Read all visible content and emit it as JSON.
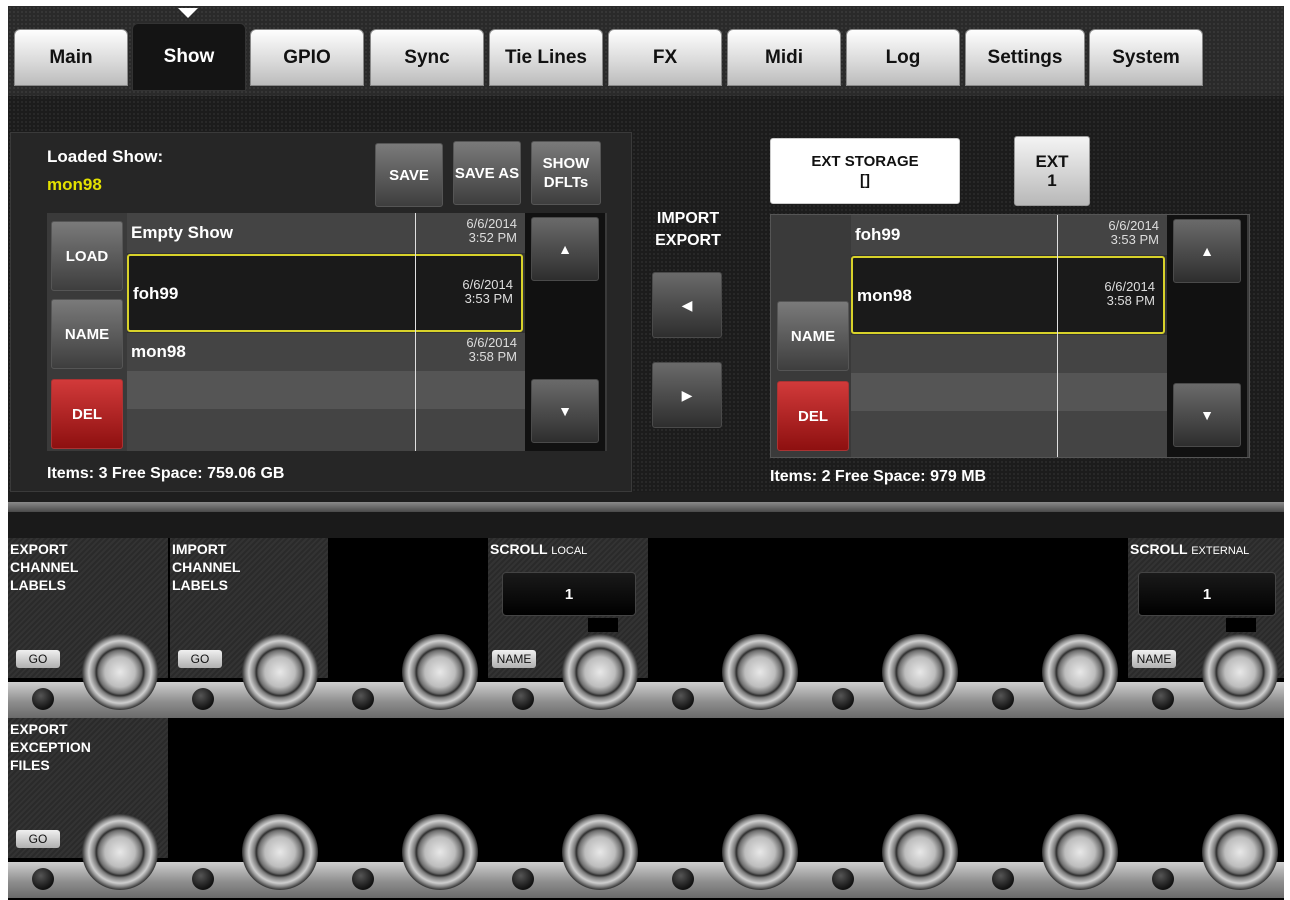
{
  "tabs": [
    "Main",
    "Show",
    "GPIO",
    "Sync",
    "Tie Lines",
    "FX",
    "Midi",
    "Log",
    "Settings",
    "System"
  ],
  "active_tab": "Show",
  "local": {
    "loaded_show_label": "Loaded Show:",
    "loaded_show_value": "mon98",
    "save_label": "SAVE",
    "save_as_label": "SAVE AS",
    "show_dflts_label": "SHOW DFLTs",
    "load_label": "LOAD",
    "name_label": "NAME",
    "del_label": "DEL",
    "rows": [
      {
        "name": "Empty Show",
        "date": "6/6/2014",
        "time": "3:52 PM"
      },
      {
        "name": "foh99",
        "date": "6/6/2014",
        "time": "3:53 PM"
      },
      {
        "name": "mon98",
        "date": "6/6/2014",
        "time": "3:58 PM"
      }
    ],
    "info": "Items: 3 Free Space: 759.06 GB"
  },
  "import_export_label": "IMPORT EXPORT",
  "external": {
    "storage_label": "EXT STORAGE",
    "storage_value": "[]",
    "ext_label": "EXT",
    "ext_value": "1",
    "name_label": "NAME",
    "del_label": "DEL",
    "rows": [
      {
        "name": "foh99",
        "date": "6/6/2014",
        "time": "3:53 PM"
      },
      {
        "name": "mon98",
        "date": "6/6/2014",
        "time": "3:58 PM"
      }
    ],
    "info": "Items: 2 Free Space: 979 MB"
  },
  "strip1": {
    "export_channel_labels": [
      "EXPORT",
      "CHANNEL",
      "LABELS"
    ],
    "import_channel_labels": [
      "IMPORT",
      "CHANNEL",
      "LABELS"
    ],
    "go_label": "GO",
    "scroll_local_title": "SCROLL",
    "scroll_local_sub": "LOCAL",
    "scroll_local_value": "1",
    "scroll_external_title": "SCROLL",
    "scroll_external_sub": "EXTERNAL",
    "scroll_external_value": "1",
    "name_label": "NAME"
  },
  "strip2": {
    "export_exception_files": [
      "EXPORT",
      "EXCEPTION",
      "FILES"
    ],
    "go_label": "GO"
  },
  "colors": {
    "accent_yellow": "#e3e100",
    "del_red": "#c02424",
    "selection": "#d8d22a"
  }
}
